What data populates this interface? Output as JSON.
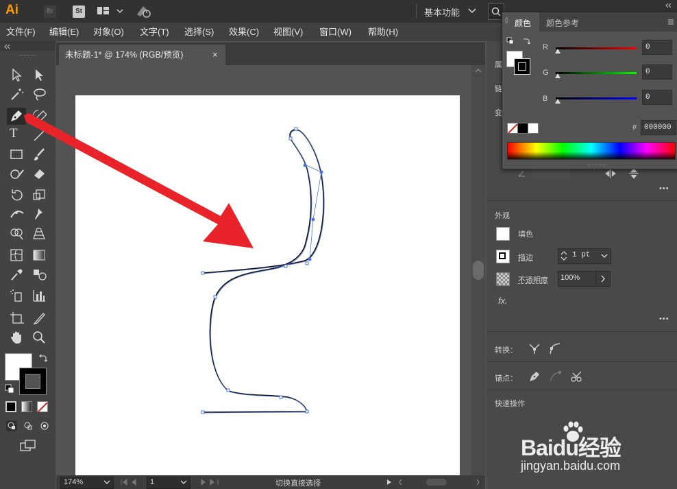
{
  "app": {
    "logo": "Ai",
    "bridge": "Br",
    "stock": "St",
    "workspace": "基本功能"
  },
  "menu": [
    "文件(F)",
    "编辑(E)",
    "对象(O)",
    "文字(T)",
    "选择(S)",
    "效果(C)",
    "视图(V)",
    "窗口(W)",
    "帮助(H)"
  ],
  "document": {
    "tab_title": "未标题-1* @ 174% (RGB/预览)",
    "close": "×"
  },
  "status": {
    "zoom": "174%",
    "artboard": "1",
    "tool_hint": "切换直接选择"
  },
  "color_panel": {
    "tab_color": "颜色",
    "tab_guide": "颜色参考",
    "r_label": "R",
    "r_value": "0",
    "g_label": "G",
    "g_value": "0",
    "b_label": "B",
    "b_value": "0",
    "hash": "#",
    "hex": "000000"
  },
  "right_panel": {
    "props_label_1": "属",
    "props_label_2": "链",
    "props_label_3": "变",
    "appearance_title": "外观",
    "fill_label": "填色",
    "stroke_label": "描边",
    "stroke_weight": "1 pt",
    "opacity_label": "不透明度",
    "opacity_value": "100%",
    "fx": "fx.",
    "convert_label": "转换：",
    "anchor_label": "锚点：",
    "quick_actions": "快速操作",
    "more": "•••"
  },
  "watermark": {
    "brand": "Baidu经验",
    "url": "jingyan.baidu.com"
  },
  "colors": {
    "accent_arrow": "#e8242a",
    "path_handles": "#4a74e0"
  }
}
